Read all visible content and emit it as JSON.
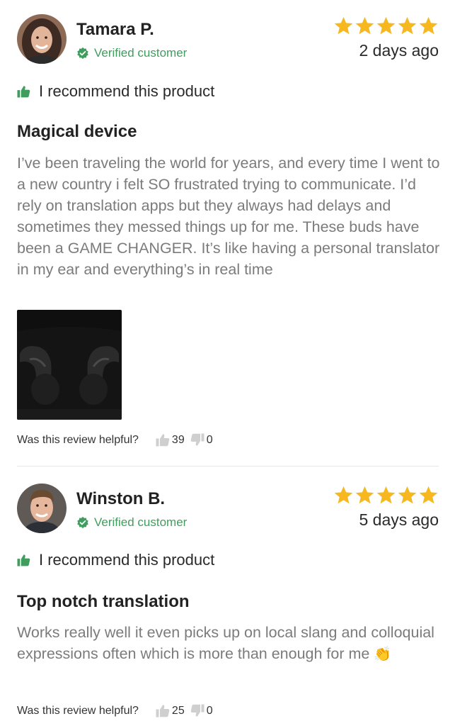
{
  "reviews": [
    {
      "author": "Tamara P.",
      "verified_label": "Verified customer",
      "rating": 5,
      "date": "2 days ago",
      "recommend": "I recommend this product",
      "title": "Magical device",
      "body": "I’ve been traveling the world for years, and every time I went to a new country i felt SO frustrated trying to communicate. I’d rely on translation apps but they always had delays and sometimes they messed things up for me. These buds have been a GAME CHANGER. It’s like having a personal translator in my ear and everything’s in real time",
      "has_photo": true,
      "helpful_question": "Was this review helpful?",
      "helpful_yes": "39",
      "helpful_no": "0"
    },
    {
      "author": "Winston B.",
      "verified_label": "Verified customer",
      "rating": 5,
      "date": "5 days ago",
      "recommend": "I recommend this product",
      "title": "Top notch translation",
      "body": "Works really well it even picks up on local slang and colloquial expressions often which is more than enough for me",
      "body_emoji": "👏",
      "has_photo": false,
      "helpful_question": "Was this review helpful?",
      "helpful_yes": "25",
      "helpful_no": "0"
    }
  ],
  "colors": {
    "star": "#f7b81f",
    "verified": "#3f9e5d",
    "recommend_icon": "#3f9e5d",
    "body_text": "#7b7b7b",
    "vote_icon": "#c9c9c9"
  },
  "icons": {
    "verified": "verified-badge-icon",
    "star": "star-icon",
    "recommend": "thumbs-up-icon",
    "helpful_yes": "thumbs-up-icon",
    "helpful_no": "thumbs-down-icon"
  }
}
